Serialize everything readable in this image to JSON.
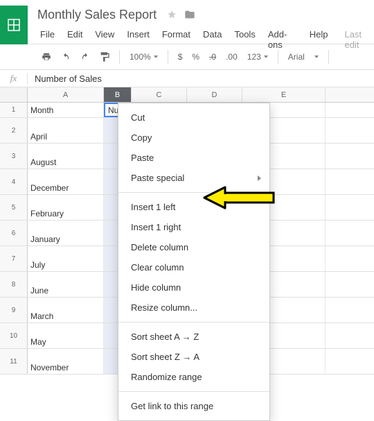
{
  "doc": {
    "title": "Monthly Sales Report"
  },
  "menu": {
    "file": "File",
    "edit": "Edit",
    "view": "View",
    "insert": "Insert",
    "format": "Format",
    "data": "Data",
    "tools": "Tools",
    "addons": "Add-ons",
    "help": "Help",
    "last_edit": "Last edit"
  },
  "toolbar": {
    "zoom": "100%",
    "currency": "$",
    "percent": "%",
    "dec_dec": ".0",
    "inc_dec": ".00",
    "num_fmt": "123",
    "font": "Arial"
  },
  "formula_bar": {
    "fx": "fx",
    "value": "Number of Sales"
  },
  "columns": {
    "A": "A",
    "B": "B",
    "C": "C",
    "D": "D",
    "E": "E"
  },
  "rows": [
    {
      "n": "1",
      "A": "Month",
      "B": "Num"
    },
    {
      "n": "2",
      "A": "April",
      "B": ""
    },
    {
      "n": "3",
      "A": "August",
      "B": ""
    },
    {
      "n": "4",
      "A": "December",
      "B": ""
    },
    {
      "n": "5",
      "A": "February",
      "B": ""
    },
    {
      "n": "6",
      "A": "January",
      "B": ""
    },
    {
      "n": "7",
      "A": "July",
      "B": ""
    },
    {
      "n": "8",
      "A": "June",
      "B": ""
    },
    {
      "n": "9",
      "A": "March",
      "B": ""
    },
    {
      "n": "10",
      "A": "May",
      "B": ""
    },
    {
      "n": "11",
      "A": "November",
      "B": ""
    }
  ],
  "ctx": {
    "cut": "Cut",
    "copy": "Copy",
    "paste": "Paste",
    "paste_special": "Paste special",
    "insert_left": "Insert 1 left",
    "insert_right": "Insert 1 right",
    "delete_col": "Delete column",
    "clear_col": "Clear column",
    "hide_col": "Hide column",
    "resize_col": "Resize column...",
    "sort_az": "Sort sheet A → Z",
    "sort_za": "Sort sheet Z → A",
    "randomize": "Randomize range",
    "get_link": "Get link to this range"
  }
}
